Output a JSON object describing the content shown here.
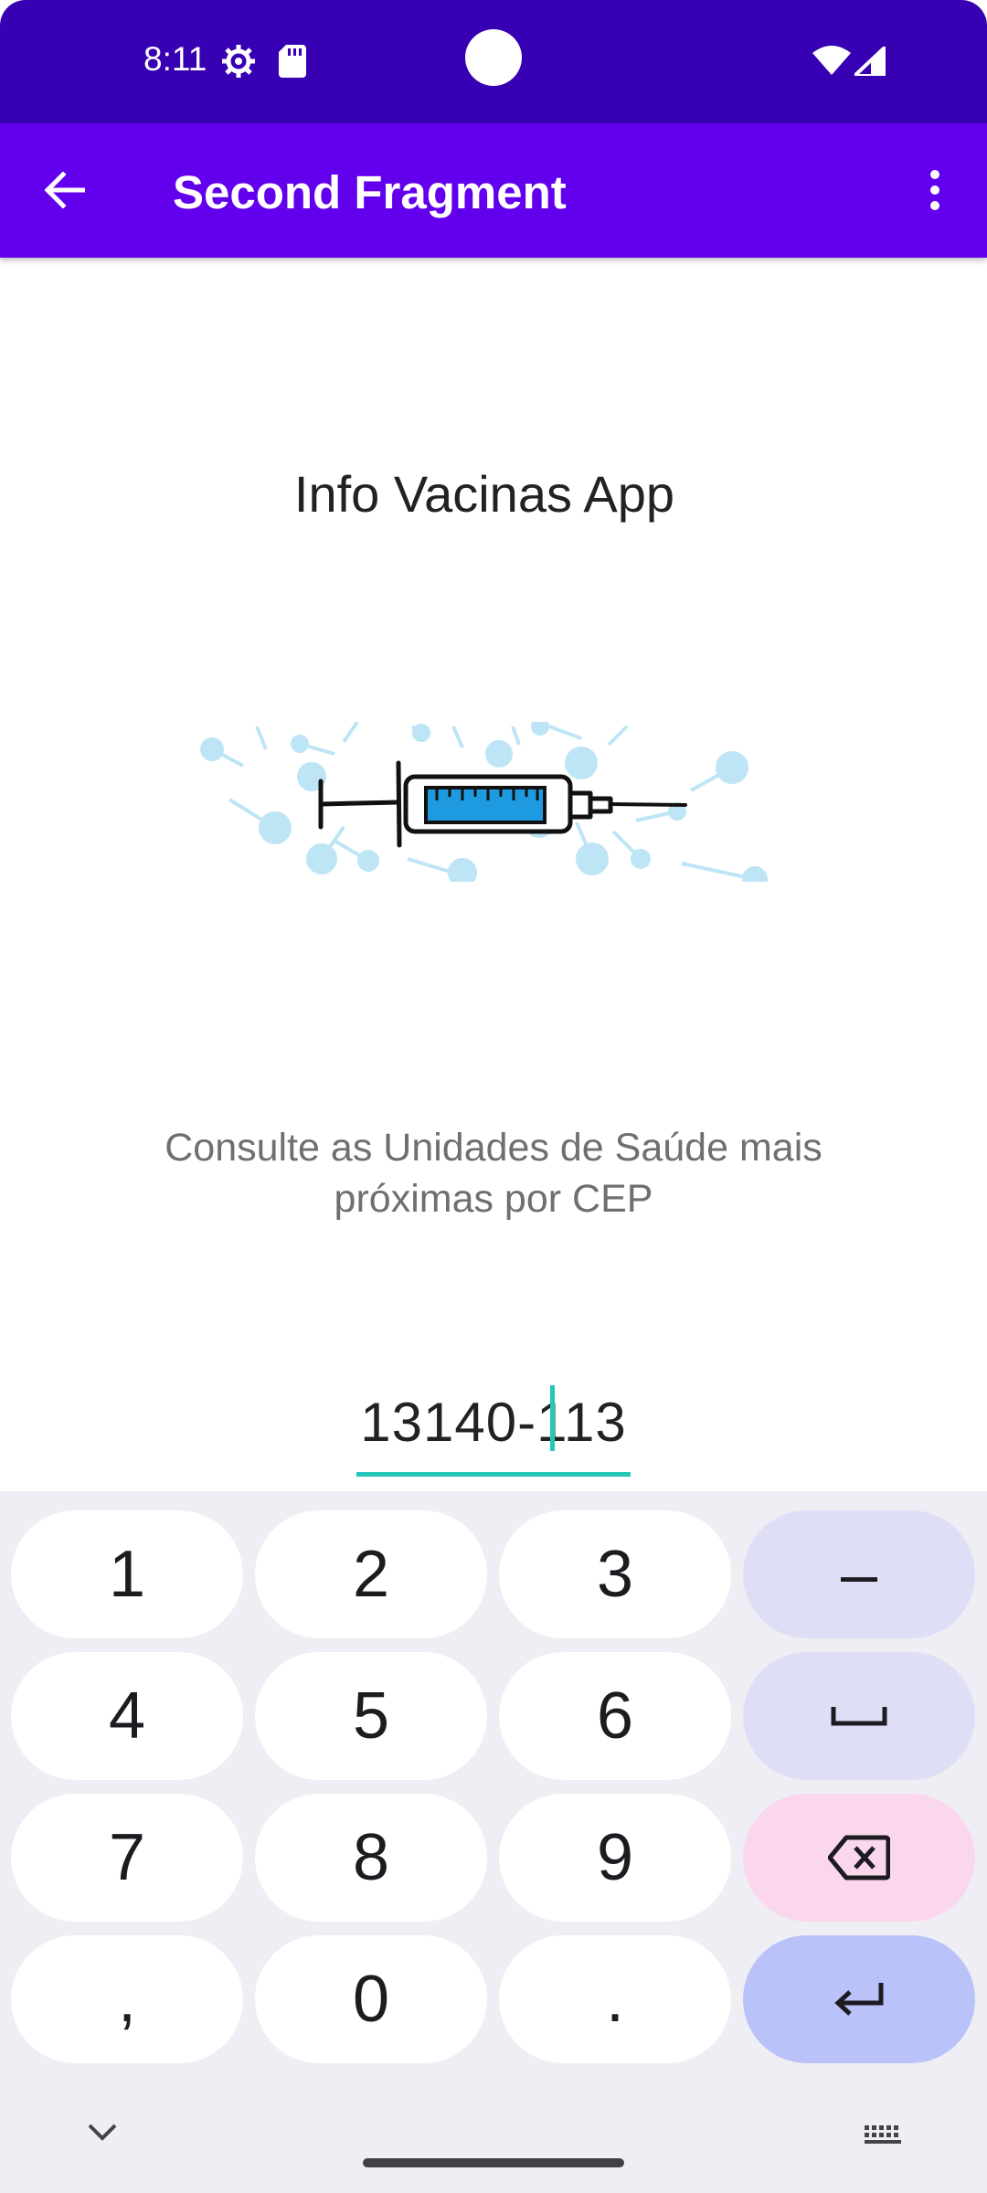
{
  "status_bar": {
    "time": "8:11",
    "icons": [
      "settings-gear-icon",
      "sd-card-icon",
      "wifi-icon",
      "cell-signal-icon"
    ]
  },
  "app_bar": {
    "title": "Second Fragment",
    "icons": [
      "arrow-back-icon",
      "more-vert-icon"
    ]
  },
  "content": {
    "headline": "Info Vacinas App",
    "hero_image": "syringe-illustration",
    "subtitle": "Consulte as Unidades de Saúde mais próximas por CEP",
    "cep_value": "13140-113"
  },
  "keyboard": {
    "rows": [
      [
        "1",
        "2",
        "3",
        "–"
      ],
      [
        "4",
        "5",
        "6",
        "space-icon"
      ],
      [
        "7",
        "8",
        "9",
        "backspace-icon"
      ],
      [
        ",",
        "0",
        ".",
        "enter-icon"
      ]
    ],
    "bottom_icons": [
      "chevron-down-icon",
      "keyboard-switch-icon"
    ]
  },
  "colors": {
    "status_bar": "#3700B3",
    "app_bar": "#6200EE",
    "accent": "#26C6B8",
    "syringe_fluid": "#1E9BE0"
  }
}
